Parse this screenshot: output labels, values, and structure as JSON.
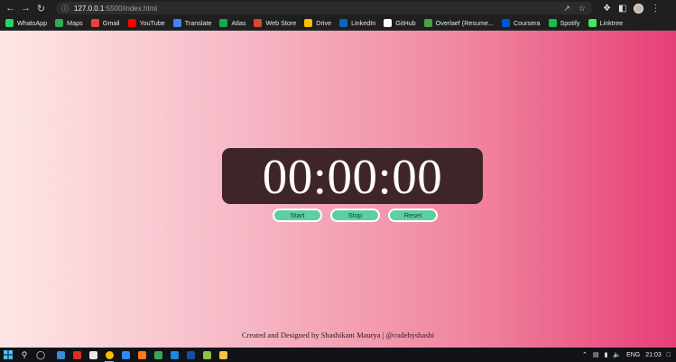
{
  "browser": {
    "address": {
      "host": "127.0.0.1",
      "path": ":5500/index.html"
    },
    "bookmarks": [
      {
        "label": "WhatsApp",
        "color": "#25d366"
      },
      {
        "label": "Maps",
        "color": "#34a853"
      },
      {
        "label": "Gmail",
        "color": "#ea4335"
      },
      {
        "label": "YouTube",
        "color": "#ff0000"
      },
      {
        "label": "Translate",
        "color": "#4285f4"
      },
      {
        "label": "Atlas",
        "color": "#13aa52"
      },
      {
        "label": "Web Store",
        "color": "#db4437"
      },
      {
        "label": "Drive",
        "color": "#fbbc04"
      },
      {
        "label": "LinkedIn",
        "color": "#0a66c2"
      },
      {
        "label": "GitHub",
        "color": "#ffffff"
      },
      {
        "label": "Overlaef (Resume...",
        "color": "#46a046"
      },
      {
        "label": "Coursera",
        "color": "#0056d2"
      },
      {
        "label": "Spotify",
        "color": "#1db954"
      },
      {
        "label": "Linktree",
        "color": "#43e55e"
      }
    ]
  },
  "stopwatch": {
    "display": "00:00:00",
    "start_label": "Start",
    "stop_label": "Stop",
    "reset_label": "Reset"
  },
  "footer": {
    "credit": "Created and Designed by Shashikant Maurya | @codebyshashi"
  },
  "taskbar": {
    "language": "ENG",
    "time": "21:03",
    "apps": [
      {
        "name": "task-view",
        "color": "#3c8ad8"
      },
      {
        "name": "app-red",
        "color": "#d93025"
      },
      {
        "name": "app-white",
        "color": "#e8e8e8"
      },
      {
        "name": "chrome",
        "color": "#fbbc04"
      },
      {
        "name": "vscode",
        "color": "#2d8cf0"
      },
      {
        "name": "app-orange",
        "color": "#ff7a1a"
      },
      {
        "name": "app-green",
        "color": "#3aa757"
      },
      {
        "name": "app-blue",
        "color": "#1e88e5"
      },
      {
        "name": "app-navy",
        "color": "#1b4f9c"
      },
      {
        "name": "app-lime",
        "color": "#8bc34a"
      },
      {
        "name": "file-explorer",
        "color": "#f6c343"
      }
    ]
  }
}
